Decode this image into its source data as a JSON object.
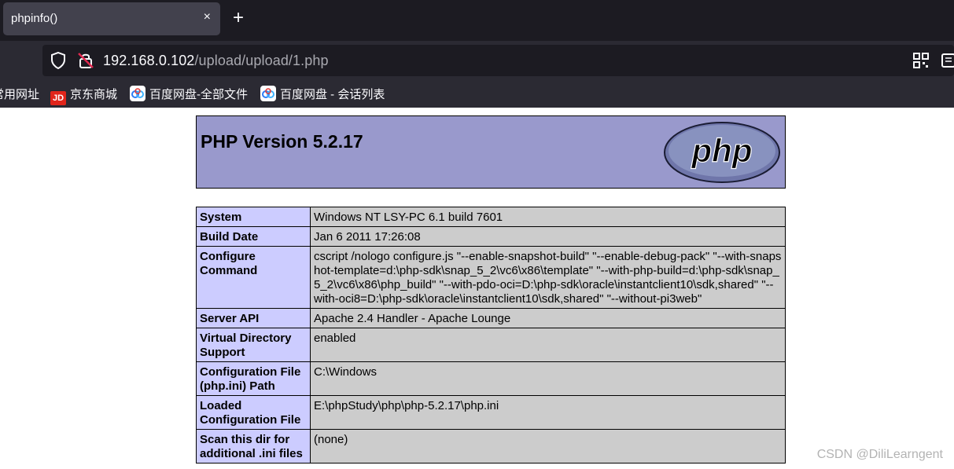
{
  "tab": {
    "title": "phpinfo()",
    "close": "×",
    "new_tab": "+"
  },
  "address": {
    "host": "192.168.0.102",
    "path": "/upload/upload/1.php"
  },
  "bookmarks": [
    {
      "label": "常用网址",
      "icon": "folder-icon"
    },
    {
      "label": "京东商城",
      "icon": "jd-icon"
    },
    {
      "label": "百度网盘-全部文件",
      "icon": "baidu-netdisk-icon"
    },
    {
      "label": "百度网盘 - 会话列表",
      "icon": "baidu-netdisk-icon"
    }
  ],
  "page": {
    "heading": "PHP Version 5.2.17",
    "logo_text": "php",
    "colors": {
      "header_bg": "#9999cc",
      "key_bg": "#ccccff",
      "value_bg": "#cccccc"
    },
    "rows": [
      {
        "key": "System",
        "value": "Windows NT LSY-PC 6.1 build 7601"
      },
      {
        "key": "Build Date",
        "value": "Jan 6 2011 17:26:08"
      },
      {
        "key": "Configure Command",
        "value": "cscript /nologo configure.js \"--enable-snapshot-build\" \"--enable-debug-pack\" \"--with-snapshot-template=d:\\php-sdk\\snap_5_2\\vc6\\x86\\template\" \"--with-php-build=d:\\php-sdk\\snap_5_2\\vc6\\x86\\php_build\" \"--with-pdo-oci=D:\\php-sdk\\oracle\\instantclient10\\sdk,shared\" \"--with-oci8=D:\\php-sdk\\oracle\\instantclient10\\sdk,shared\" \"--without-pi3web\""
      },
      {
        "key": "Server API",
        "value": "Apache 2.4 Handler - Apache Lounge"
      },
      {
        "key": "Virtual Directory Support",
        "value": "enabled"
      },
      {
        "key": "Configuration File (php.ini) Path",
        "value": "C:\\Windows"
      },
      {
        "key": "Loaded Configuration File",
        "value": "E:\\phpStudy\\php\\php-5.2.17\\php.ini"
      },
      {
        "key": "Scan this dir for additional .ini files",
        "value": "(none)"
      }
    ]
  },
  "watermark": "CSDN @DiliLearngent"
}
